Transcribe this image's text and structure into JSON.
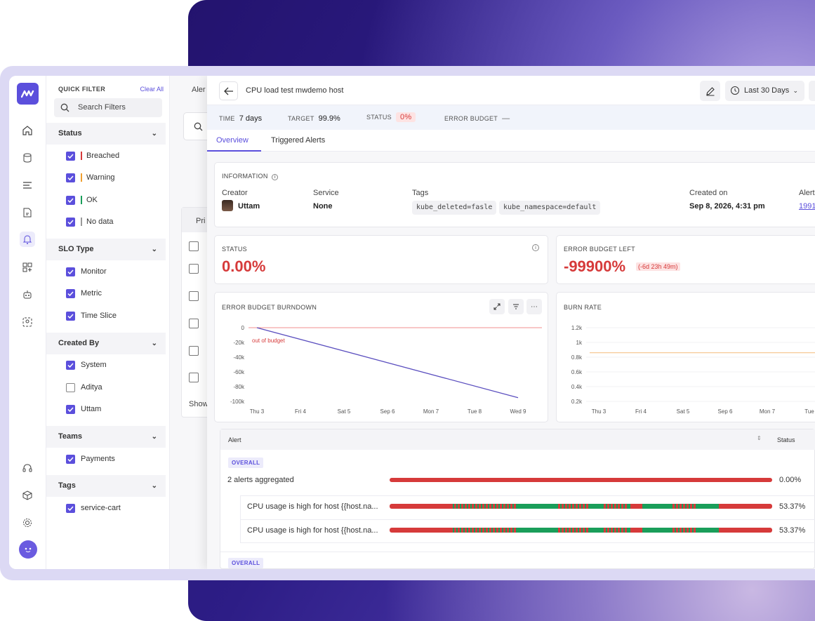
{
  "colors": {
    "brand": "#5b4fdc",
    "red": "#d63a3a",
    "green": "#1a9e5a",
    "orange": "#f0a030"
  },
  "filters": {
    "quick_filter_label": "QUICK FILTER",
    "clear_all": "Clear All",
    "search_placeholder": "Search Filters",
    "status": {
      "title": "Status",
      "options": [
        "Breached",
        "Warning",
        "OK",
        "No data"
      ]
    },
    "slo_type": {
      "title": "SLO Type",
      "options": [
        "Monitor",
        "Metric",
        "Time Slice"
      ]
    },
    "created_by": {
      "title": "Created By",
      "options": [
        "System",
        "Aditya",
        "Uttam"
      ]
    },
    "teams": {
      "title": "Teams",
      "options": [
        "Payments"
      ]
    },
    "tags": {
      "title": "Tags",
      "options": [
        "service-cart"
      ]
    }
  },
  "background_list": {
    "tab": "Aler",
    "col": "Pri",
    "footer": "Show"
  },
  "detail": {
    "title": "CPU load test mwdemo host",
    "range": "Last 30 Days",
    "meta": {
      "time_label": "TIME",
      "time_value": "7 days",
      "target_label": "TARGET",
      "target_value": "99.9%",
      "status_label": "STATUS",
      "status_value": "0%",
      "budget_label": "ERROR BUDGET",
      "budget_value": "—"
    },
    "tabs": [
      "Overview",
      "Triggered Alerts"
    ],
    "info": {
      "heading": "INFORMATION",
      "creator_label": "Creator",
      "creator": "Uttam",
      "service_label": "Service",
      "service": "None",
      "tags_label": "Tags",
      "tags": [
        "kube_deleted=fasle",
        "kube_namespace=default"
      ],
      "created_on_label": "Created on",
      "created_on": "Sep 8, 2026, 4:31 pm",
      "alert_label": "Alert",
      "alert_value": "1991"
    },
    "status_card": {
      "heading": "STATUS",
      "value": "0.00%"
    },
    "budget_left_card": {
      "heading": "ERROR BUDGET LEFT",
      "value": "-99900%",
      "note": "(-6d 23h 49m)"
    },
    "burndown": {
      "heading": "ERROR BUDGET BURNDOWN",
      "annotation": "out of budget"
    },
    "burn_rate": {
      "heading": "BURN RATE"
    },
    "alerts_table": {
      "col_alert": "Alert",
      "col_status": "Status",
      "overall_badge": "OVERALL",
      "aggregate_text": "2 alerts aggregated",
      "aggregate_pct": "0.00%",
      "rows": [
        {
          "name": "CPU usage is high for host {{host.na...",
          "pct": "53.37%"
        },
        {
          "name": "CPU usage is high for host {{host.na...",
          "pct": "53.37%"
        }
      ]
    }
  },
  "chart_data": [
    {
      "type": "line",
      "title": "ERROR BUDGET BURNDOWN",
      "categories": [
        "Thu 3",
        "Fri 4",
        "Sat 5",
        "Sep 6",
        "Mon 7",
        "Tue 8",
        "Wed 9"
      ],
      "y_ticks": [
        "0",
        "-20k",
        "-40k",
        "-60k",
        "-80k",
        "-100k"
      ],
      "ylim": [
        -100000,
        0
      ],
      "threshold": 0,
      "series": [
        {
          "x": [
            "Thu 3",
            "Wed 9"
          ],
          "values": [
            0,
            -95000
          ]
        }
      ]
    },
    {
      "type": "line",
      "title": "BURN RATE",
      "categories": [
        "Thu 3",
        "Fri 4",
        "Sat 5",
        "Sep 6",
        "Mon 7",
        "Tue"
      ],
      "y_ticks": [
        "1.2k",
        "1k",
        "0.8k",
        "0.6k",
        "0.4k",
        "0.2k"
      ],
      "ylim": [
        200,
        1200
      ],
      "series": [
        {
          "values": [
            860,
            860
          ]
        }
      ]
    }
  ]
}
